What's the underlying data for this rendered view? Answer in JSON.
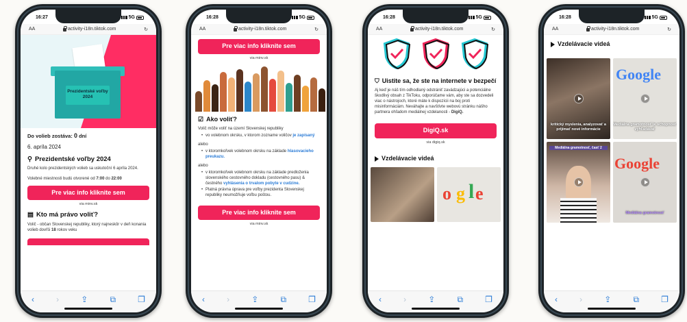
{
  "phones": [
    {
      "time": "16:27",
      "network": "5G",
      "url": "activity-i18n.tiktok.com",
      "aa": "AA"
    },
    {
      "time": "16:28",
      "network": "5G",
      "url": "activity-i18n.tiktok.com",
      "aa": "AA"
    },
    {
      "time": "16:28",
      "network": "5G",
      "url": "activity-i18n.tiktok.com",
      "aa": "AA"
    },
    {
      "time": "16:28",
      "network": "5G",
      "url": "activity-i18n.tiktok.com",
      "aa": "AA"
    }
  ],
  "p1": {
    "ballot_label_1": "Prezidentské voľby",
    "ballot_label_2": "2024",
    "countdown_label": "Do volieb zostáva:",
    "countdown_value": "0",
    "countdown_unit": "dní",
    "date": "6. apríla 2024",
    "section_title": "Prezidentské voľby 2024",
    "p1": "Druhé kolo prezidentských volieb sa uskutoční 6 apríla 2024.",
    "p2_a": "Volebné miestnosti budú otvorené od",
    "p2_from": "7:00",
    "p2_do": "do",
    "p2_to": "22:00",
    "button": "Pre viac info kliknite sem",
    "via": "via minv.sk",
    "who_title": "Kto má právo voliť?",
    "who_text_a": "Volič - občan Slovenskej republiky, ktorý najneskôr v deň konania volieb dovŕši",
    "who_age": "18",
    "who_text_b": "rokov veku"
  },
  "p2": {
    "button_top": "Pre viac info kliknite sem",
    "via_top": "via minv.sk",
    "title": "Ako voliť?",
    "intro": "Volič môže voliť na území Slovenskej republiky",
    "b1": "vo volebnom okrsku, v ktorom zozname voličov",
    "b1_link": "je zapísaný",
    "or1": "alebo",
    "b2": "v ktoromkoľvek volebnom okrsku na základe",
    "b2_link": "hlasovacieho preukazu.",
    "or2": "alebo",
    "b3": "v ktoromkoľvek volebnom okrsku na základe predloženia slovenského cestovného dokladu (cestovného pasu) & čestného",
    "b3_link": "vyhlásenia o trvalom pobyte v cudzine.",
    "b4": "Platná právna úprava pre voľby prezidenta Slovenskej republiky neumožňuje voľbu poštou.",
    "button_bottom": "Pre viac info kliknite sem",
    "via_bottom": "via minv.sk"
  },
  "p3": {
    "title": "Uistite sa, že ste na internete v bezpečí",
    "text_a": "Aj keď je náš tím odhodlaný odstrániť zavádzajúci a potenciálne škodlivý obsah z TikToku, odporúčame vám, aby ste sa dozvedeli viac o nástrojoch, ktoré máte k dispozícii na boj proti misinformáciám. Neváhajte a navštívte webovú stránku nášho partnera ohľadom mediálnej vzdelanosti -",
    "text_b": "DigiQ.",
    "button": "DigiQ.sk",
    "via": "via digiq.sk",
    "videos_title": "Vzdelávacie videá"
  },
  "p4": {
    "videos_title": "Vzdelávacie videá",
    "v1_caption": "kritický myslenia, analyzovať a prijímať nové informácie",
    "v2_caption": "Mediálna gramotnosť je schopnosť vyhľadávať",
    "v2_logo": "Google",
    "v3_caption": "Mediálna gramotnosť, časť 2",
    "v4_logo": "Google",
    "v4_caption": "Mediálna gramotnosť"
  }
}
